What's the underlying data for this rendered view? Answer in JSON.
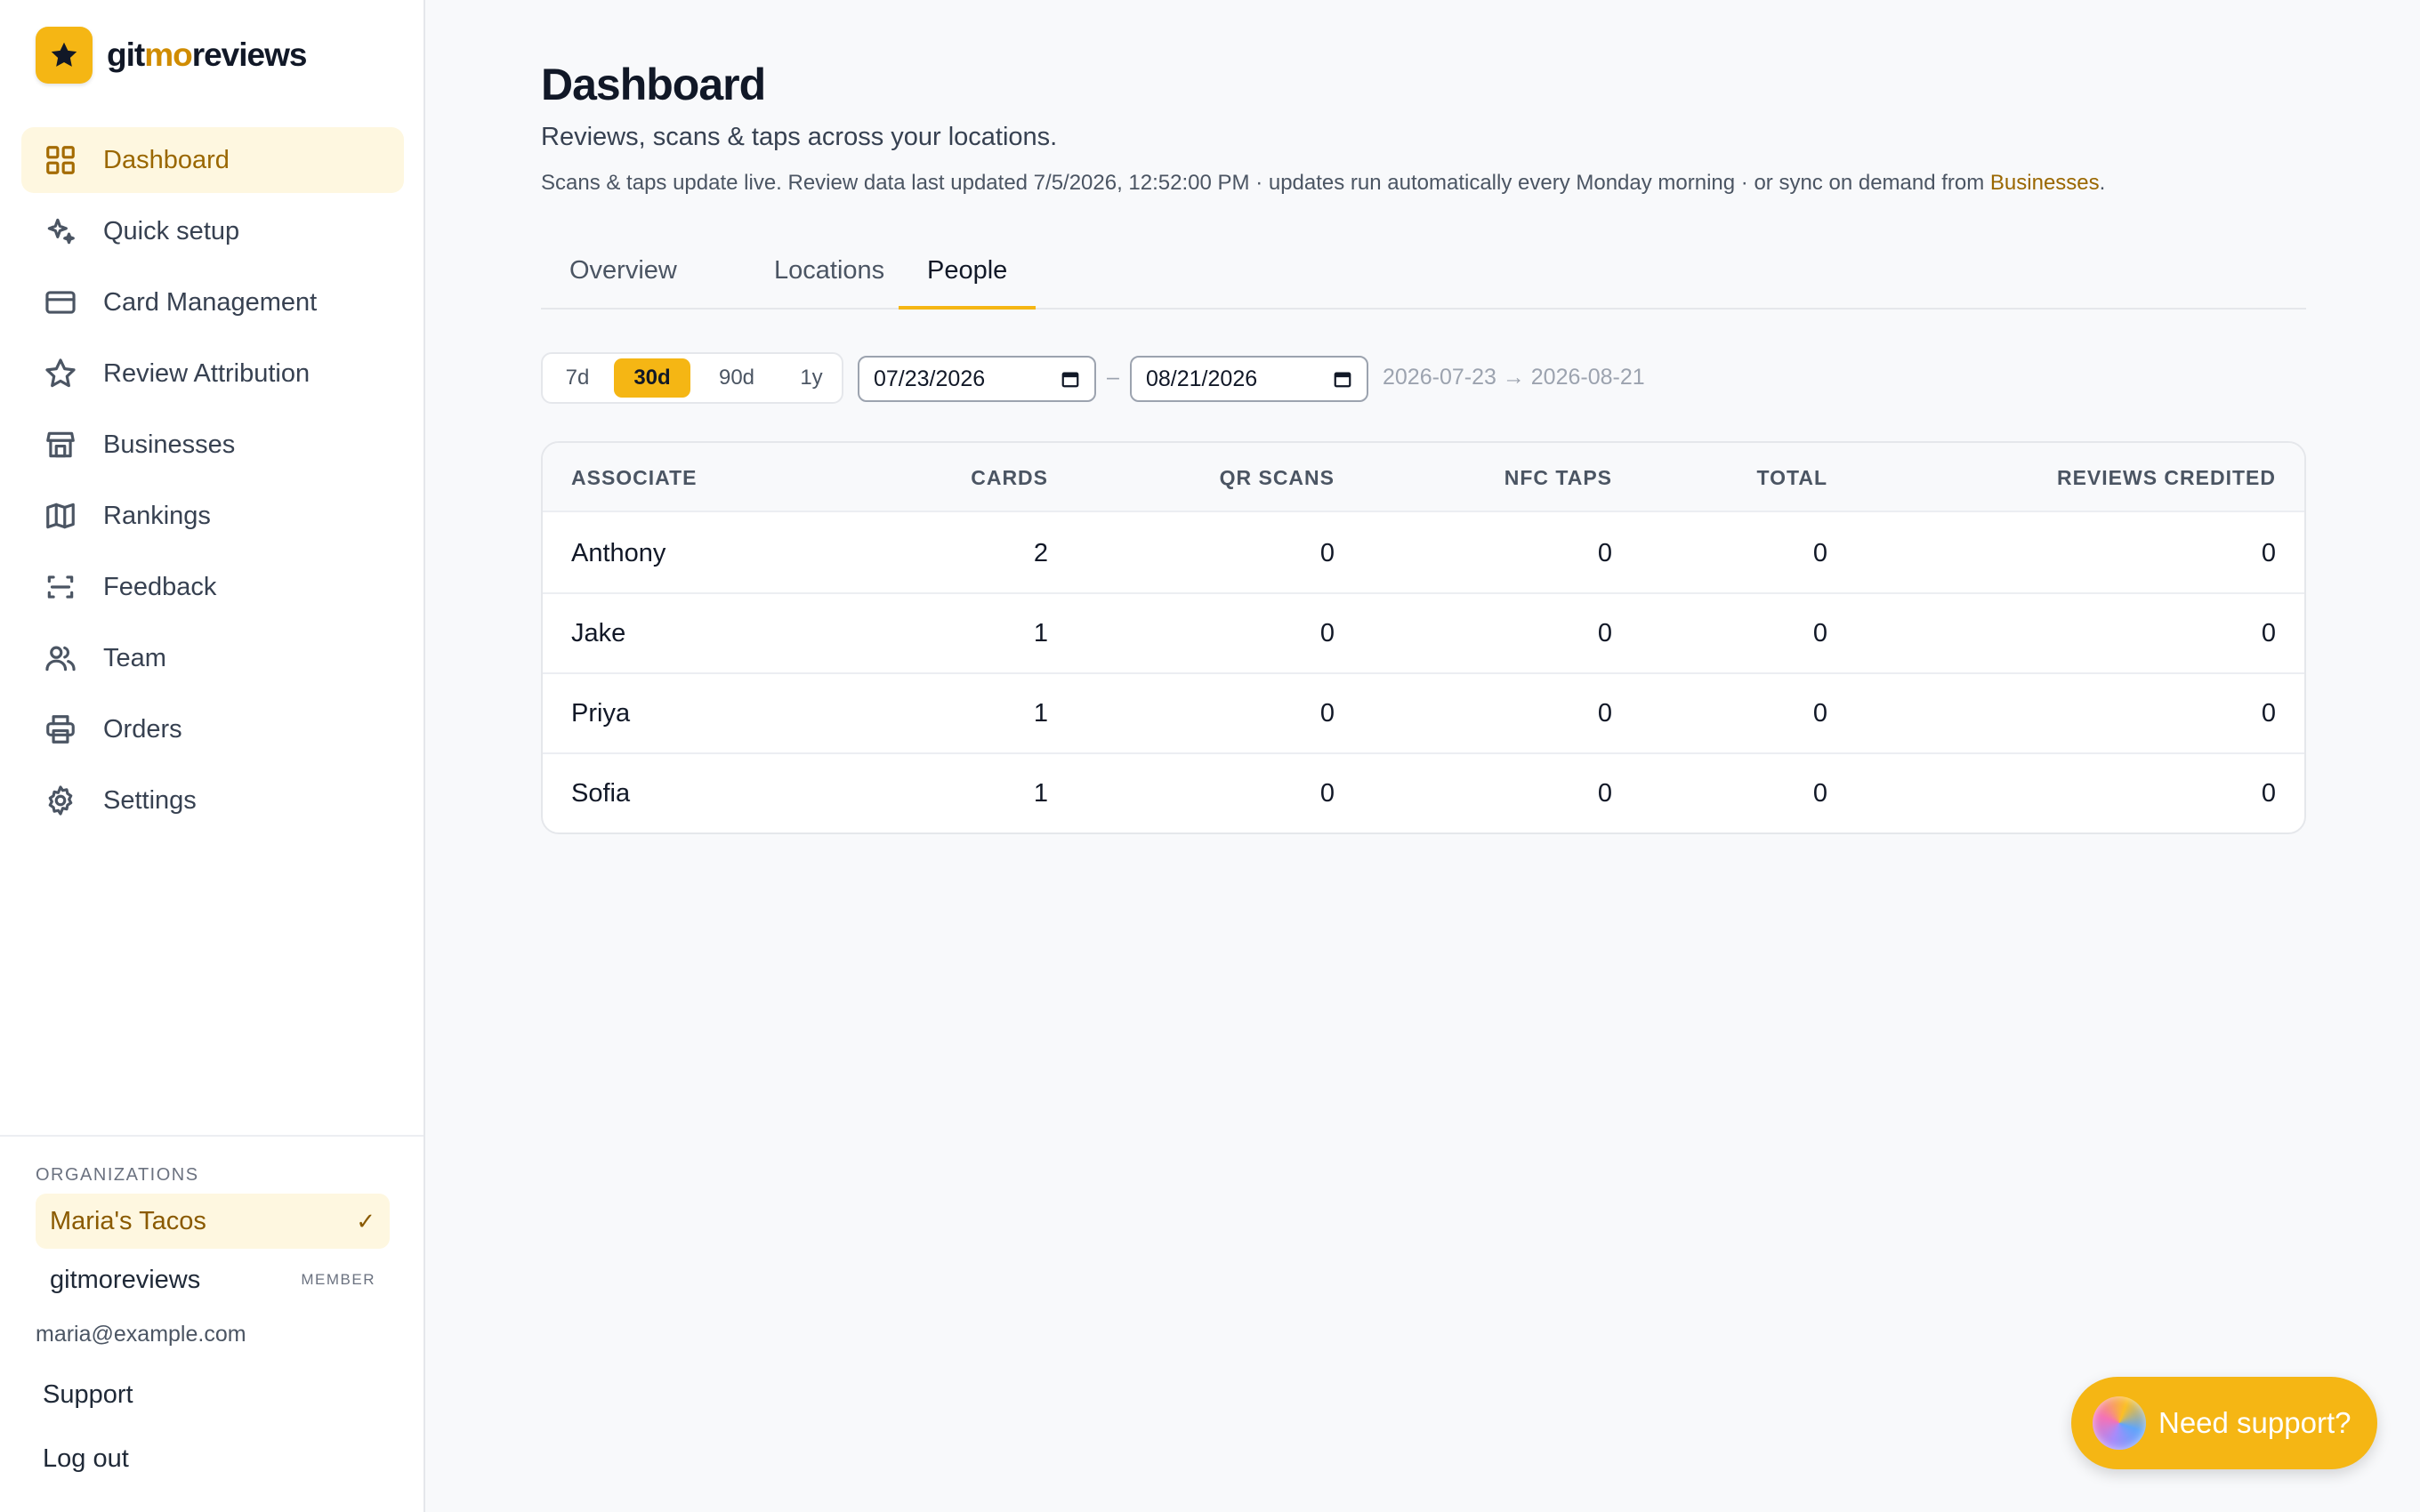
{
  "brand": {
    "name_prefix": "git",
    "name_accent": "mo",
    "name_suffix": "reviews"
  },
  "sidebar": {
    "items": [
      {
        "label": "Dashboard",
        "icon": "grid-icon",
        "active": true
      },
      {
        "label": "Quick setup",
        "icon": "sparkle-icon"
      },
      {
        "label": "Card Management",
        "icon": "credit-card-icon"
      },
      {
        "label": "Review Attribution",
        "icon": "star-icon"
      },
      {
        "label": "Businesses",
        "icon": "store-icon"
      },
      {
        "label": "Rankings",
        "icon": "map-icon"
      },
      {
        "label": "Feedback",
        "icon": "scan-icon"
      },
      {
        "label": "Team",
        "icon": "users-icon"
      },
      {
        "label": "Orders",
        "icon": "printer-icon"
      },
      {
        "label": "Settings",
        "icon": "gear-icon"
      }
    ],
    "organizations_heading": "ORGANIZATIONS",
    "organizations": [
      {
        "name": "Maria's Tacos",
        "selected_mark": "✓"
      },
      {
        "name": "gitmoreviews",
        "badge": "MEMBER"
      }
    ],
    "user_email": "maria@example.com",
    "support_label": "Support",
    "logout_label": "Log out"
  },
  "header": {
    "title": "Dashboard",
    "subtitle": "Reviews, scans & taps across your locations.",
    "note_prefix": "Scans & taps update live. Review data last updated 7/5/2026, 12:52:00 PM · updates run automatically every Monday morning · or sync on demand from ",
    "note_link": "Businesses",
    "note_suffix": "."
  },
  "tabs": [
    {
      "label": "Overview"
    },
    {
      "label": "Locations"
    },
    {
      "label": "People",
      "active": true
    }
  ],
  "filters": {
    "ranges": [
      "7d",
      "30d",
      "90d",
      "1y"
    ],
    "selected_range": "30d",
    "from_date": "07/23/2026",
    "separator": "–",
    "to_date": "08/21/2026",
    "readout": "2026-07-23 → 2026-08-21"
  },
  "table": {
    "headers": [
      "ASSOCIATE",
      "CARDS",
      "QR SCANS",
      "NFC TAPS",
      "TOTAL",
      "REVIEWS CREDITED"
    ],
    "rows": [
      {
        "associate": "Anthony",
        "cards": "2",
        "qr_scans": "0",
        "nfc_taps": "0",
        "total": "0",
        "reviews_credited": "0"
      },
      {
        "associate": "Jake",
        "cards": "1",
        "qr_scans": "0",
        "nfc_taps": "0",
        "total": "0",
        "reviews_credited": "0"
      },
      {
        "associate": "Priya",
        "cards": "1",
        "qr_scans": "0",
        "nfc_taps": "0",
        "total": "0",
        "reviews_credited": "0"
      },
      {
        "associate": "Sofia",
        "cards": "1",
        "qr_scans": "0",
        "nfc_taps": "0",
        "total": "0",
        "reviews_credited": "0"
      }
    ]
  },
  "support_widget": {
    "label": "Need support?"
  },
  "colors": {
    "accent": "#f5b614",
    "accent_text": "#9a6700",
    "active_bg": "#fef7e0"
  }
}
